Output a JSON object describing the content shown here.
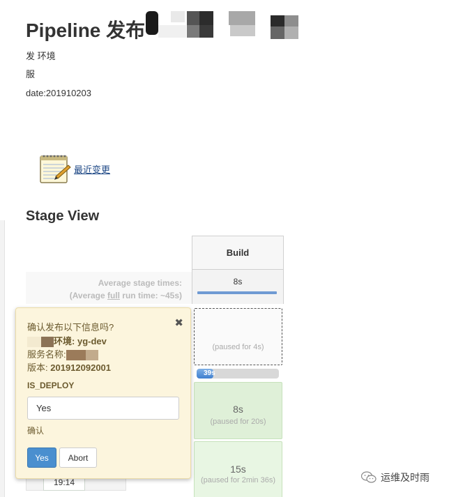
{
  "page": {
    "title": "Pipeline 发布",
    "description_lines": [
      "发 环境",
      "服",
      "date:201910203"
    ]
  },
  "changes": {
    "label": "最近变更"
  },
  "stage_view": {
    "title": "Stage View",
    "stage_header": "Build",
    "avg_label_line1": "Average stage times:",
    "avg_label_prefix": "(Average ",
    "avg_label_full": "full",
    "avg_label_suffix": " run time: ~45s)",
    "avg_time": "8s",
    "runs": [
      {
        "paused_text": "(paused for 4s)",
        "progress_label": "39s",
        "progress_fraction": 0.2
      },
      {
        "duration": "8s",
        "paused_text": "(paused for 20s)",
        "status": "success"
      },
      {
        "duration": "15s",
        "paused_text": "(paused for 2min 36s)",
        "status": "success"
      }
    ],
    "row_time": "19:14"
  },
  "input_dialog": {
    "close_glyph": "✖",
    "question": "确认发布以下信息吗?",
    "env_label": "环境:",
    "env_value": "yg-dev",
    "service_label": "服务名称:",
    "version_label": "版本:",
    "version_value": "201912092001",
    "param_name": "IS_DEPLOY",
    "param_value": "Yes",
    "param_description": "确认",
    "yes_label": "Yes",
    "abort_label": "Abort"
  },
  "watermark": {
    "text": "运维及时雨"
  },
  "colors": {
    "accent_blue": "#4a8fcf",
    "success_green": "#dff0d8",
    "dialog_bg": "#fcf5dd",
    "link": "#204a87"
  }
}
